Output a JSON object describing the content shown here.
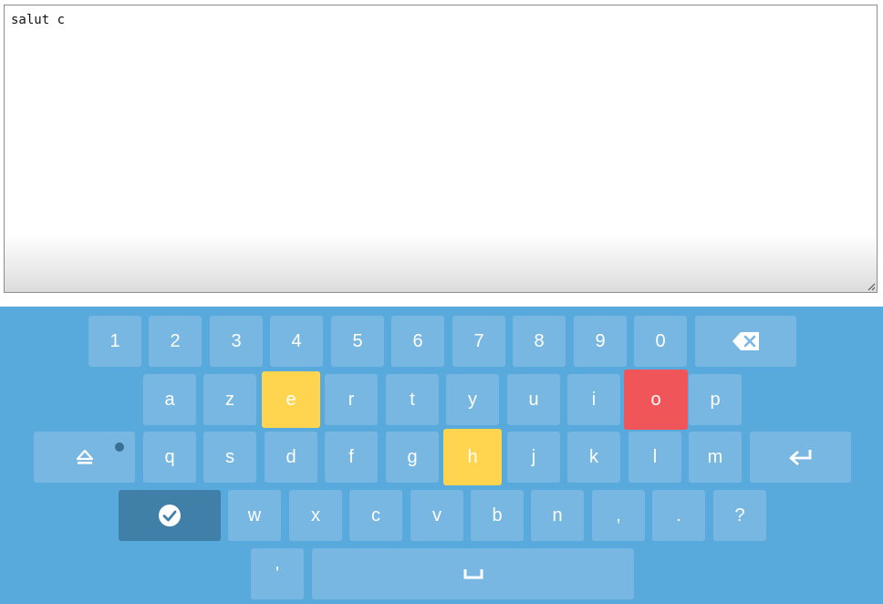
{
  "editor": {
    "text": "salut c"
  },
  "keyboard": {
    "row1": [
      "1",
      "2",
      "3",
      "4",
      "5",
      "6",
      "7",
      "8",
      "9",
      "0"
    ],
    "row2": [
      "a",
      "z",
      "e",
      "r",
      "t",
      "y",
      "u",
      "i",
      "o",
      "p"
    ],
    "row3": [
      "q",
      "s",
      "d",
      "f",
      "g",
      "h",
      "j",
      "k",
      "l",
      "m"
    ],
    "row4": [
      "w",
      "x",
      "c",
      "v",
      "b",
      "n",
      ",",
      ".",
      "?"
    ],
    "row5": [
      "'"
    ],
    "special_icons": {
      "backspace": "backspace-icon",
      "shift": "shift-icon",
      "enter": "enter-icon",
      "confirm": "check-circle-icon",
      "space": "space-icon"
    },
    "highlights": {
      "e": "#ffd54f",
      "h": "#ffd54f",
      "o": "#f0555a"
    },
    "colors": {
      "background": "#58a9dc",
      "key": "#78b7e2",
      "confirm_key": "#3f7fa8"
    }
  }
}
